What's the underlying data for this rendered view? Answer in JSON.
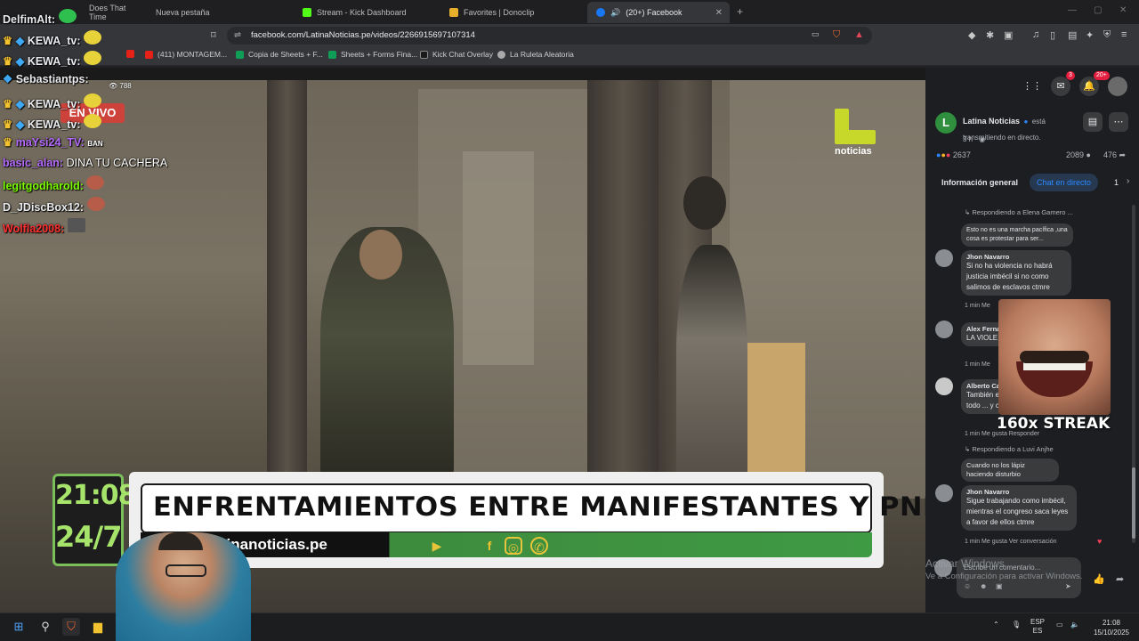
{
  "tabs": [
    {
      "label": "Does That Time",
      "active": false
    },
    {
      "label": "Nueva pestaña",
      "active": false
    },
    {
      "label": "Stream - Kick Dashboard",
      "active": false
    },
    {
      "label": "Favorites | Donoclip",
      "active": false
    },
    {
      "label": "(20+) Facebook",
      "active": true
    }
  ],
  "address_bar": {
    "url": "facebook.com/LatinaNoticias.pe/videos/2266915697107314"
  },
  "bookmarks": [
    {
      "label": "(411) MONTAGEM..."
    },
    {
      "label": "Copia de Sheets + F..."
    },
    {
      "label": "Sheets + Forms Fina..."
    },
    {
      "label": "Kick Chat Overlay"
    },
    {
      "label": "La Ruleta Aleatoria"
    }
  ],
  "overlay_chat": [
    {
      "user": "DelfimAlt:",
      "message": "",
      "color": "#ffffff"
    },
    {
      "user": "KEWA_tv:",
      "message": "",
      "color": "#ffffff"
    },
    {
      "user": "KEWA_tv:",
      "message": "",
      "color": "#ffffff"
    },
    {
      "user": "Sebastiantps:",
      "message": "",
      "color": "#ffffff"
    },
    {
      "user": "KEWA_tv:",
      "message": "",
      "color": "#ffffff"
    },
    {
      "user": "KEWA_tv:",
      "message": "",
      "color": "#ffffff"
    },
    {
      "user": "maYsi24_TV:",
      "message": "",
      "color": "#b56cff"
    },
    {
      "user": "basic_alan:",
      "message": "DINA TU CACHERA",
      "color": "#b56cff"
    },
    {
      "user": "legitgodharold:",
      "message": "",
      "color": "#7cfc00"
    },
    {
      "user": "D_JDiscBox12:",
      "message": "",
      "color": "#ffffff"
    },
    {
      "user": "Wolfla2008:",
      "message": "",
      "color": "#ff3030"
    }
  ],
  "live": {
    "label": "EN VIVO",
    "viewers": "788",
    "ban_tag": "BAN"
  },
  "news_logo": {
    "text": "noticias"
  },
  "lower_third": {
    "time": "21:08",
    "tag": "24/7",
    "headline": "ENFRENTAMIENTOS ENTRE MANIFESTANTES Y PNP",
    "website": "Vi...s en latinanoticias.pe"
  },
  "fb": {
    "badges": {
      "messenger": "3",
      "notifications": "20+"
    },
    "page_name": "Latina Noticias",
    "status": "está transmitiendo en directo.",
    "age": "3 h ·",
    "reactions": "2637",
    "comments_count": "2089",
    "shares": "476",
    "tabs": [
      "Información general",
      "Chat en directo",
      "1"
    ],
    "comments": [
      {
        "reply_to": "Respondiendo a Elena Gamero ...",
        "name": "",
        "text": "Esto no es una marcha pacífica ,una cosa es protestar para ser...",
        "meta": ""
      },
      {
        "reply_to": "",
        "name": "Jhon Navarro",
        "text": "Si no ha violencia no habrá justicia imbécil si no como salimos de esclavos ctmre",
        "meta": "1 min   Me"
      },
      {
        "reply_to": "",
        "name": "Alex Ferna...",
        "text": "LA VIOLE... MAS VIO...",
        "meta": "1 min   Me"
      },
      {
        "reply_to": "",
        "name": "Alberto Ca...",
        "text": "También e... pie de luc... sobre todo ... y chimo",
        "meta": "1 min   Me gusta   Responder"
      },
      {
        "reply_to": "Respondiendo a Luvi Anjhe",
        "name": "",
        "text": "Cuando no los lápiz haciendo disturbio",
        "meta": ""
      },
      {
        "reply_to": "",
        "name": "Jhon Navarro",
        "text": "Sigue trabajando como imbécil, mientras el congreso saca leyes a favor de ellos ctmre",
        "meta": "1 min   Me gusta   Ver conversación"
      }
    ],
    "streak": "160x STREAK",
    "composer_placeholder": "Escribe un comentario..."
  },
  "windows_activation": {
    "line1": "Activar Windows",
    "line2": "Ve a Configuración para activar Windows."
  },
  "taskbar": {
    "lang": "ESP",
    "lang2": "ES",
    "time": "21:08",
    "date": "15/10/2025"
  }
}
